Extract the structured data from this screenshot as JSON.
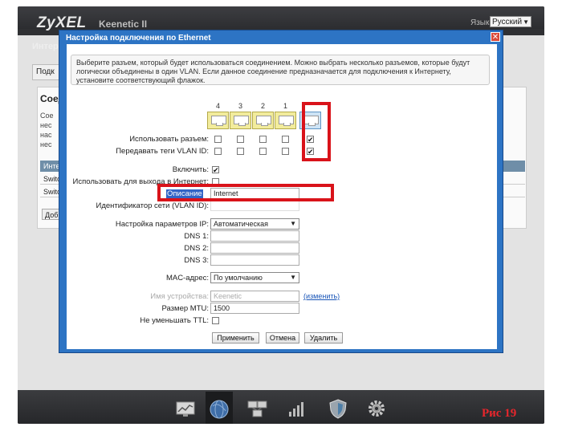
{
  "header": {
    "brand": "ZyXEL",
    "model": "Keenetic II",
    "language_label": "Язык:",
    "language_value": "Русский"
  },
  "background": {
    "title": "Интер",
    "tab": "Подк",
    "section_title": "Соед",
    "section_text": "Сое\nнес\nнас\nнес",
    "table_header": "Инте",
    "rows": [
      "Switc",
      "Switc"
    ],
    "add_button": "Доб"
  },
  "dialog": {
    "title": "Настройка подключения по Ethernet",
    "hint": "Выберите разъем, который будет использоваться соединением. Можно выбрать несколько разъемов, которые будут логически объединены в один VLAN. Если данное соединение предназначается для подключения к Интернету, установите соответствующий флажок.",
    "ports": [
      {
        "number": "4",
        "use": false,
        "vlan_tags": false
      },
      {
        "number": "3",
        "use": false,
        "vlan_tags": false
      },
      {
        "number": "2",
        "use": false,
        "vlan_tags": false
      },
      {
        "number": "1",
        "use": false,
        "vlan_tags": false
      },
      {
        "number": "",
        "use": true,
        "vlan_tags": true
      }
    ],
    "use_port_label": "Использовать разъем:",
    "vlan_tags_label": "Передавать теги VLAN ID:",
    "enable_label": "Включить:",
    "enable_checked": true,
    "internet_label": "Использовать для выхода в Интернет:",
    "internet_checked": false,
    "description_label": "Описание",
    "description_value": "Internet",
    "vlan_id_label": "Идентификатор сети (VLAN ID):",
    "ip_settings_label": "Настройка параметров IP:",
    "ip_settings_value": "Автоматическая",
    "dns1_label": "DNS 1:",
    "dns2_label": "DNS 2:",
    "dns3_label": "DNS 3:",
    "mac_label": "MAC-адрес:",
    "mac_value": "По умолчанию",
    "device_name_label": "Имя устройства:",
    "device_name_value": "Keenetic",
    "change_link": "(изменить)",
    "mtu_label": "Размер MTU:",
    "mtu_value": "1500",
    "ttl_label": "Не уменьшать TTL:",
    "ttl_checked": false,
    "apply_label": "Применить",
    "cancel_label": "Отмена",
    "delete_label": "Удалить"
  },
  "bottom_nav": [
    {
      "icon": "monitor-chart-icon",
      "active": false
    },
    {
      "icon": "globe-icon",
      "active": true
    },
    {
      "icon": "network-computers-icon",
      "active": false
    },
    {
      "icon": "signal-bars-icon",
      "active": false
    },
    {
      "icon": "shield-icon",
      "active": false
    },
    {
      "icon": "gear-icon",
      "active": false
    }
  ],
  "figure_caption": "Рис 19",
  "colors": {
    "dialog_header": "#2d74c4",
    "highlight": "#d9131a",
    "wan_port": "#cde3f5",
    "lan_port": "#f2ec9c"
  }
}
